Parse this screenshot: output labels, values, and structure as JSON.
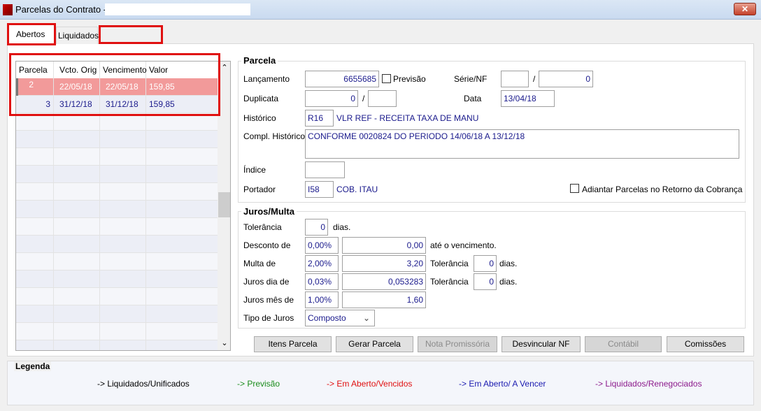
{
  "window": {
    "title": "Parcelas do Contrato -",
    "close_label": "✕"
  },
  "tabs": [
    {
      "label": "Abertos",
      "active": true
    },
    {
      "label": "Liquidados",
      "active": false
    },
    {
      "label": "",
      "active": false
    }
  ],
  "grid": {
    "columns": [
      "Parcela",
      "Vcto. Orig",
      "Vencimento",
      "Valor"
    ],
    "rows": [
      {
        "parcela": "2",
        "vcto_orig": "22/05/18",
        "vencimento": "22/05/18",
        "valor": "159,85",
        "status": "vencido",
        "color": "#f29a9a"
      },
      {
        "parcela": "3",
        "vcto_orig": "31/12/18",
        "vencimento": "31/12/18",
        "valor": "159,85",
        "status": "a_vencer",
        "color": "#1a1a8c"
      }
    ]
  },
  "parcela": {
    "title": "Parcela",
    "lancamento_label": "Lançamento",
    "lancamento": "6655685",
    "previsao_label": "Previsão",
    "previsao_checked": false,
    "serie_nf_label": "Série/NF",
    "serie": "",
    "nf": "0",
    "slash": "/",
    "duplicata_label": "Duplicata",
    "duplicata": "0",
    "duplicata2": "",
    "data_label": "Data",
    "data": "13/04/18",
    "historico_label": "Histórico",
    "historico_code": "R16",
    "historico_desc": "VLR REF - RECEITA TAXA DE MANU",
    "compl_label": "Compl. Histórico",
    "compl": "CONFORME 0020824 DO PERIODO 14/06/18 A 13/12/18",
    "indice_label": "Índice",
    "indice": "",
    "portador_label": "Portador",
    "portador_code": "I58",
    "portador_desc": "COB. ITAU",
    "adiantar_label": "Adiantar Parcelas no Retorno da Cobrança",
    "adiantar_checked": false
  },
  "juros": {
    "title": "Juros/Multa",
    "tolerancia_label": "Tolerância",
    "tolerancia": "0",
    "dias": "dias.",
    "desconto_label": "Desconto de",
    "desconto_pct": "0,00%",
    "desconto_val": "0,00",
    "ate_venc": "até o vencimento.",
    "multa_label": "Multa de",
    "multa_pct": "2,00%",
    "multa_val": "3,20",
    "multa_tol": "0",
    "juros_dia_label": "Juros dia de",
    "juros_dia_pct": "0,03%",
    "juros_dia_val": "0,053283",
    "juros_dia_tol": "0",
    "juros_mes_label": "Juros mês de",
    "juros_mes_pct": "1,00%",
    "juros_mes_val": "1,60",
    "tipo_label": "Tipo de Juros",
    "tipo": "Composto"
  },
  "buttons": [
    {
      "label": "Itens Parcela",
      "enabled": true
    },
    {
      "label": "Gerar Parcela",
      "enabled": true
    },
    {
      "label": "Nota Promissória",
      "enabled": false
    },
    {
      "label": "Desvincular NF",
      "enabled": true
    },
    {
      "label": "Contábil",
      "enabled": false
    },
    {
      "label": "Comissões",
      "enabled": true
    }
  ],
  "legend": {
    "title": "Legenda",
    "items": [
      {
        "label": "-> Liquidados/Unificados",
        "color": "#000000"
      },
      {
        "label": "-> Previsão",
        "color": "#1a8c1a"
      },
      {
        "label": "-> Em Aberto/Vencidos",
        "color": "#e01010"
      },
      {
        "label": "-> Em Aberto/ A Vencer",
        "color": "#1a1ab0"
      },
      {
        "label": "-> Liquidados/Renegociados",
        "color": "#8c1a8c"
      }
    ]
  }
}
